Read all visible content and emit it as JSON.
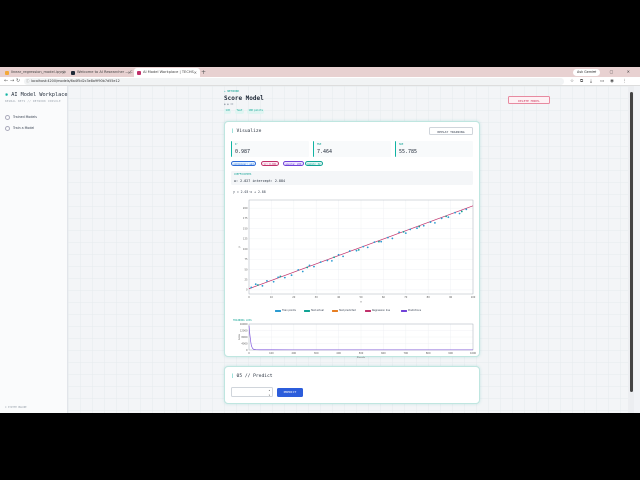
{
  "browser": {
    "tabs": [
      {
        "title": "linear_regression_model.ipynb",
        "favicon_color": "#f4a93a",
        "active": false
      },
      {
        "title": "Welcome to AI Researcher — C",
        "favicon_color": "#1f2937",
        "active": false
      },
      {
        "title": "AI Model Workplace | TECHS",
        "favicon_color": "#c0306a",
        "active": true
      }
    ],
    "new_tab": "+",
    "url": "localhost:4200/models/6a4f5d2c3e8a9f90b7d55e12",
    "update_label": "Ask Gemini",
    "window_controls": "— ▢ ✕"
  },
  "sidebar": {
    "brand": "AI Model Workplace",
    "brand_icon": "✱",
    "subtitle": "NEURAL NETS // NETWORK CONSOLE",
    "items": [
      {
        "label": "Trained Models",
        "icon": "cube-icon"
      },
      {
        "label": "Train a Model",
        "icon": "plus-icon"
      }
    ],
    "footer": "© SYSTEM ONLINE"
  },
  "header": {
    "back": "← NETWORK",
    "title": "Score Model",
    "meta": "● ● ID",
    "tags": [
      {
        "text": "1d3",
        "bg": "#e0f5f2",
        "fg": "#10a394"
      },
      {
        "text": "Test",
        "bg": "#e0f5f2",
        "fg": "#10a394"
      },
      {
        "text": "100 points",
        "bg": "#e0f5f2",
        "fg": "#10a394"
      }
    ],
    "delete_label": "DELETE MODEL"
  },
  "visualize": {
    "title": "Visualize",
    "replay_label": "REPLAY TRAINING",
    "metrics": [
      {
        "label": "R²",
        "value": "0.987"
      },
      {
        "label": "MSE",
        "value": "7.464"
      },
      {
        "label": "MAE",
        "value": "55.785"
      }
    ],
    "chips": [
      {
        "text": "optimizer: sgd",
        "bg": "#e6f4ff",
        "fg": "#2c6ad6"
      },
      {
        "text": "lr: 0.001",
        "bg": "#fbeaf3",
        "fg": "#c0306a"
      },
      {
        "text": "epochs: 200",
        "bg": "#efe7ff",
        "fg": "#7042d8"
      },
      {
        "text": "batch: 32",
        "bg": "#e0f5f2",
        "fg": "#10a394"
      }
    ],
    "coefficients_label": "COEFFICIENTS",
    "coefficients_value": "w: 2.027   intercept: 2.884",
    "equation": "y = 2.03·x + 2.88",
    "legend": [
      {
        "label": "Train points",
        "color": "#2b9bd1"
      },
      {
        "label": "Test actual",
        "color": "#10a394"
      },
      {
        "label": "Test predicted",
        "color": "#e67e22"
      },
      {
        "label": "Regression line",
        "color": "#c0306a"
      },
      {
        "label": "Predictions",
        "color": "#7042d8"
      }
    ],
    "loss_label": "TRAINING LOSS"
  },
  "predict": {
    "title": "05 // Predict",
    "input_value": "",
    "button_label": "PREDICT"
  },
  "chart_data": [
    {
      "type": "scatter",
      "xlabel": "x",
      "ylabel": "y",
      "xlim": [
        0,
        100
      ],
      "ylim": [
        -10,
        220
      ],
      "xticks": [
        0,
        10,
        20,
        30,
        40,
        50,
        60,
        70,
        80,
        90,
        100
      ],
      "yticks": [
        0,
        25,
        50,
        75,
        100,
        125,
        150,
        175,
        200
      ],
      "grid": true,
      "regression_line": {
        "slope": 2.03,
        "intercept": 2.88,
        "color": "#c0306a"
      },
      "series": [
        {
          "name": "Train points",
          "color": "#2b9bd1",
          "x": [
            1,
            3,
            6,
            8,
            11,
            13,
            16,
            19,
            22,
            24,
            27,
            29,
            32,
            35,
            37,
            40,
            42,
            45,
            48,
            51,
            53,
            56,
            59,
            62,
            64,
            67,
            70,
            72,
            75,
            78,
            81,
            83,
            86,
            89,
            92,
            94,
            97
          ],
          "y": [
            6,
            14,
            10,
            22,
            20,
            31,
            30,
            36,
            49,
            45,
            60,
            57,
            68,
            72,
            71,
            86,
            82,
            95,
            96,
            106,
            104,
            117,
            118,
            128,
            126,
            141,
            139,
            148,
            151,
            157,
            166,
            164,
            175,
            178,
            189,
            187,
            197
          ]
        },
        {
          "name": "Test actual",
          "color": "#10a394",
          "x": [
            4,
            14,
            26,
            38,
            49,
            58,
            69,
            76,
            88,
            95
          ],
          "y": [
            12,
            33,
            55,
            80,
            98,
            118,
            142,
            155,
            180,
            192
          ]
        },
        {
          "name": "Test predicted",
          "color": "#e67e22",
          "x": [],
          "y": []
        }
      ]
    },
    {
      "type": "line",
      "xlabel": "Epoch",
      "ylabel": "Loss",
      "xlim": [
        0,
        1000
      ],
      "ylim": [
        0,
        16000
      ],
      "xticks": [
        0,
        100,
        200,
        300,
        400,
        500,
        600,
        700,
        800,
        900,
        1000
      ],
      "yticks": [
        0,
        4000,
        8000,
        12000,
        16000
      ],
      "grid": true,
      "series": [
        {
          "name": "loss",
          "color": "#7042d8",
          "x": [
            0,
            5,
            10,
            15,
            20,
            30,
            50,
            100,
            200,
            400,
            700,
            1000
          ],
          "y": [
            15000,
            8000,
            3000,
            1200,
            500,
            200,
            120,
            90,
            80,
            76,
            75,
            75
          ]
        }
      ]
    }
  ]
}
